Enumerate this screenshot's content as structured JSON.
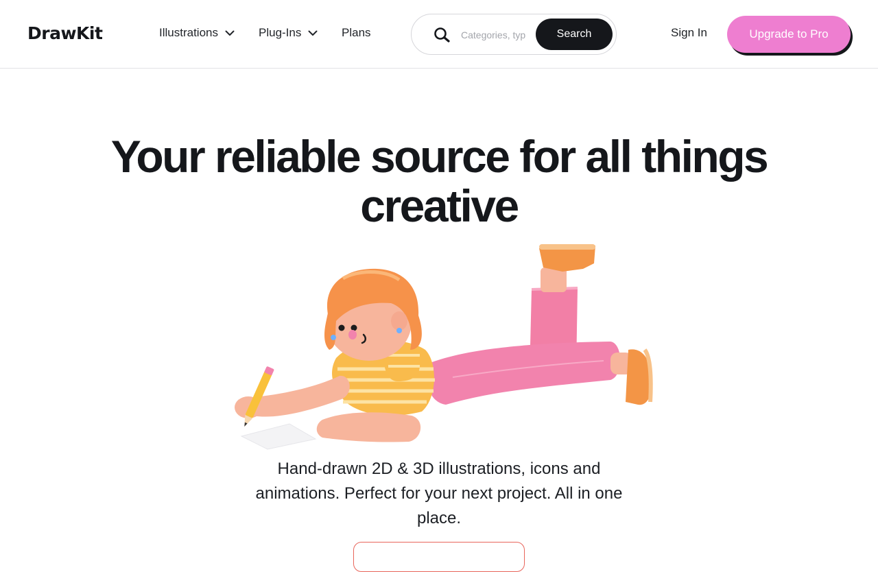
{
  "header": {
    "logo": "DrawKit",
    "nav": [
      {
        "label": "Illustrations",
        "has_dropdown": true
      },
      {
        "label": "Plug-Ins",
        "has_dropdown": true
      },
      {
        "label": "Plans",
        "has_dropdown": false
      }
    ],
    "search": {
      "placeholder": "Categories, types...",
      "button_label": "Search",
      "icon": "search-icon"
    },
    "sign_in_label": "Sign In",
    "upgrade_label": "Upgrade to Pro"
  },
  "hero": {
    "headline": "Your reliable source for all things creative",
    "subtitle": "Hand-drawn 2D & 3D illustrations, icons and animations. Perfect for your next project. All in one place.",
    "illustration": "3d-girl-lying-drawing-illustration"
  },
  "colors": {
    "brand_dark": "#15171b",
    "accent_pink": "#ee7ed0",
    "cta_border": "#e8645a"
  }
}
